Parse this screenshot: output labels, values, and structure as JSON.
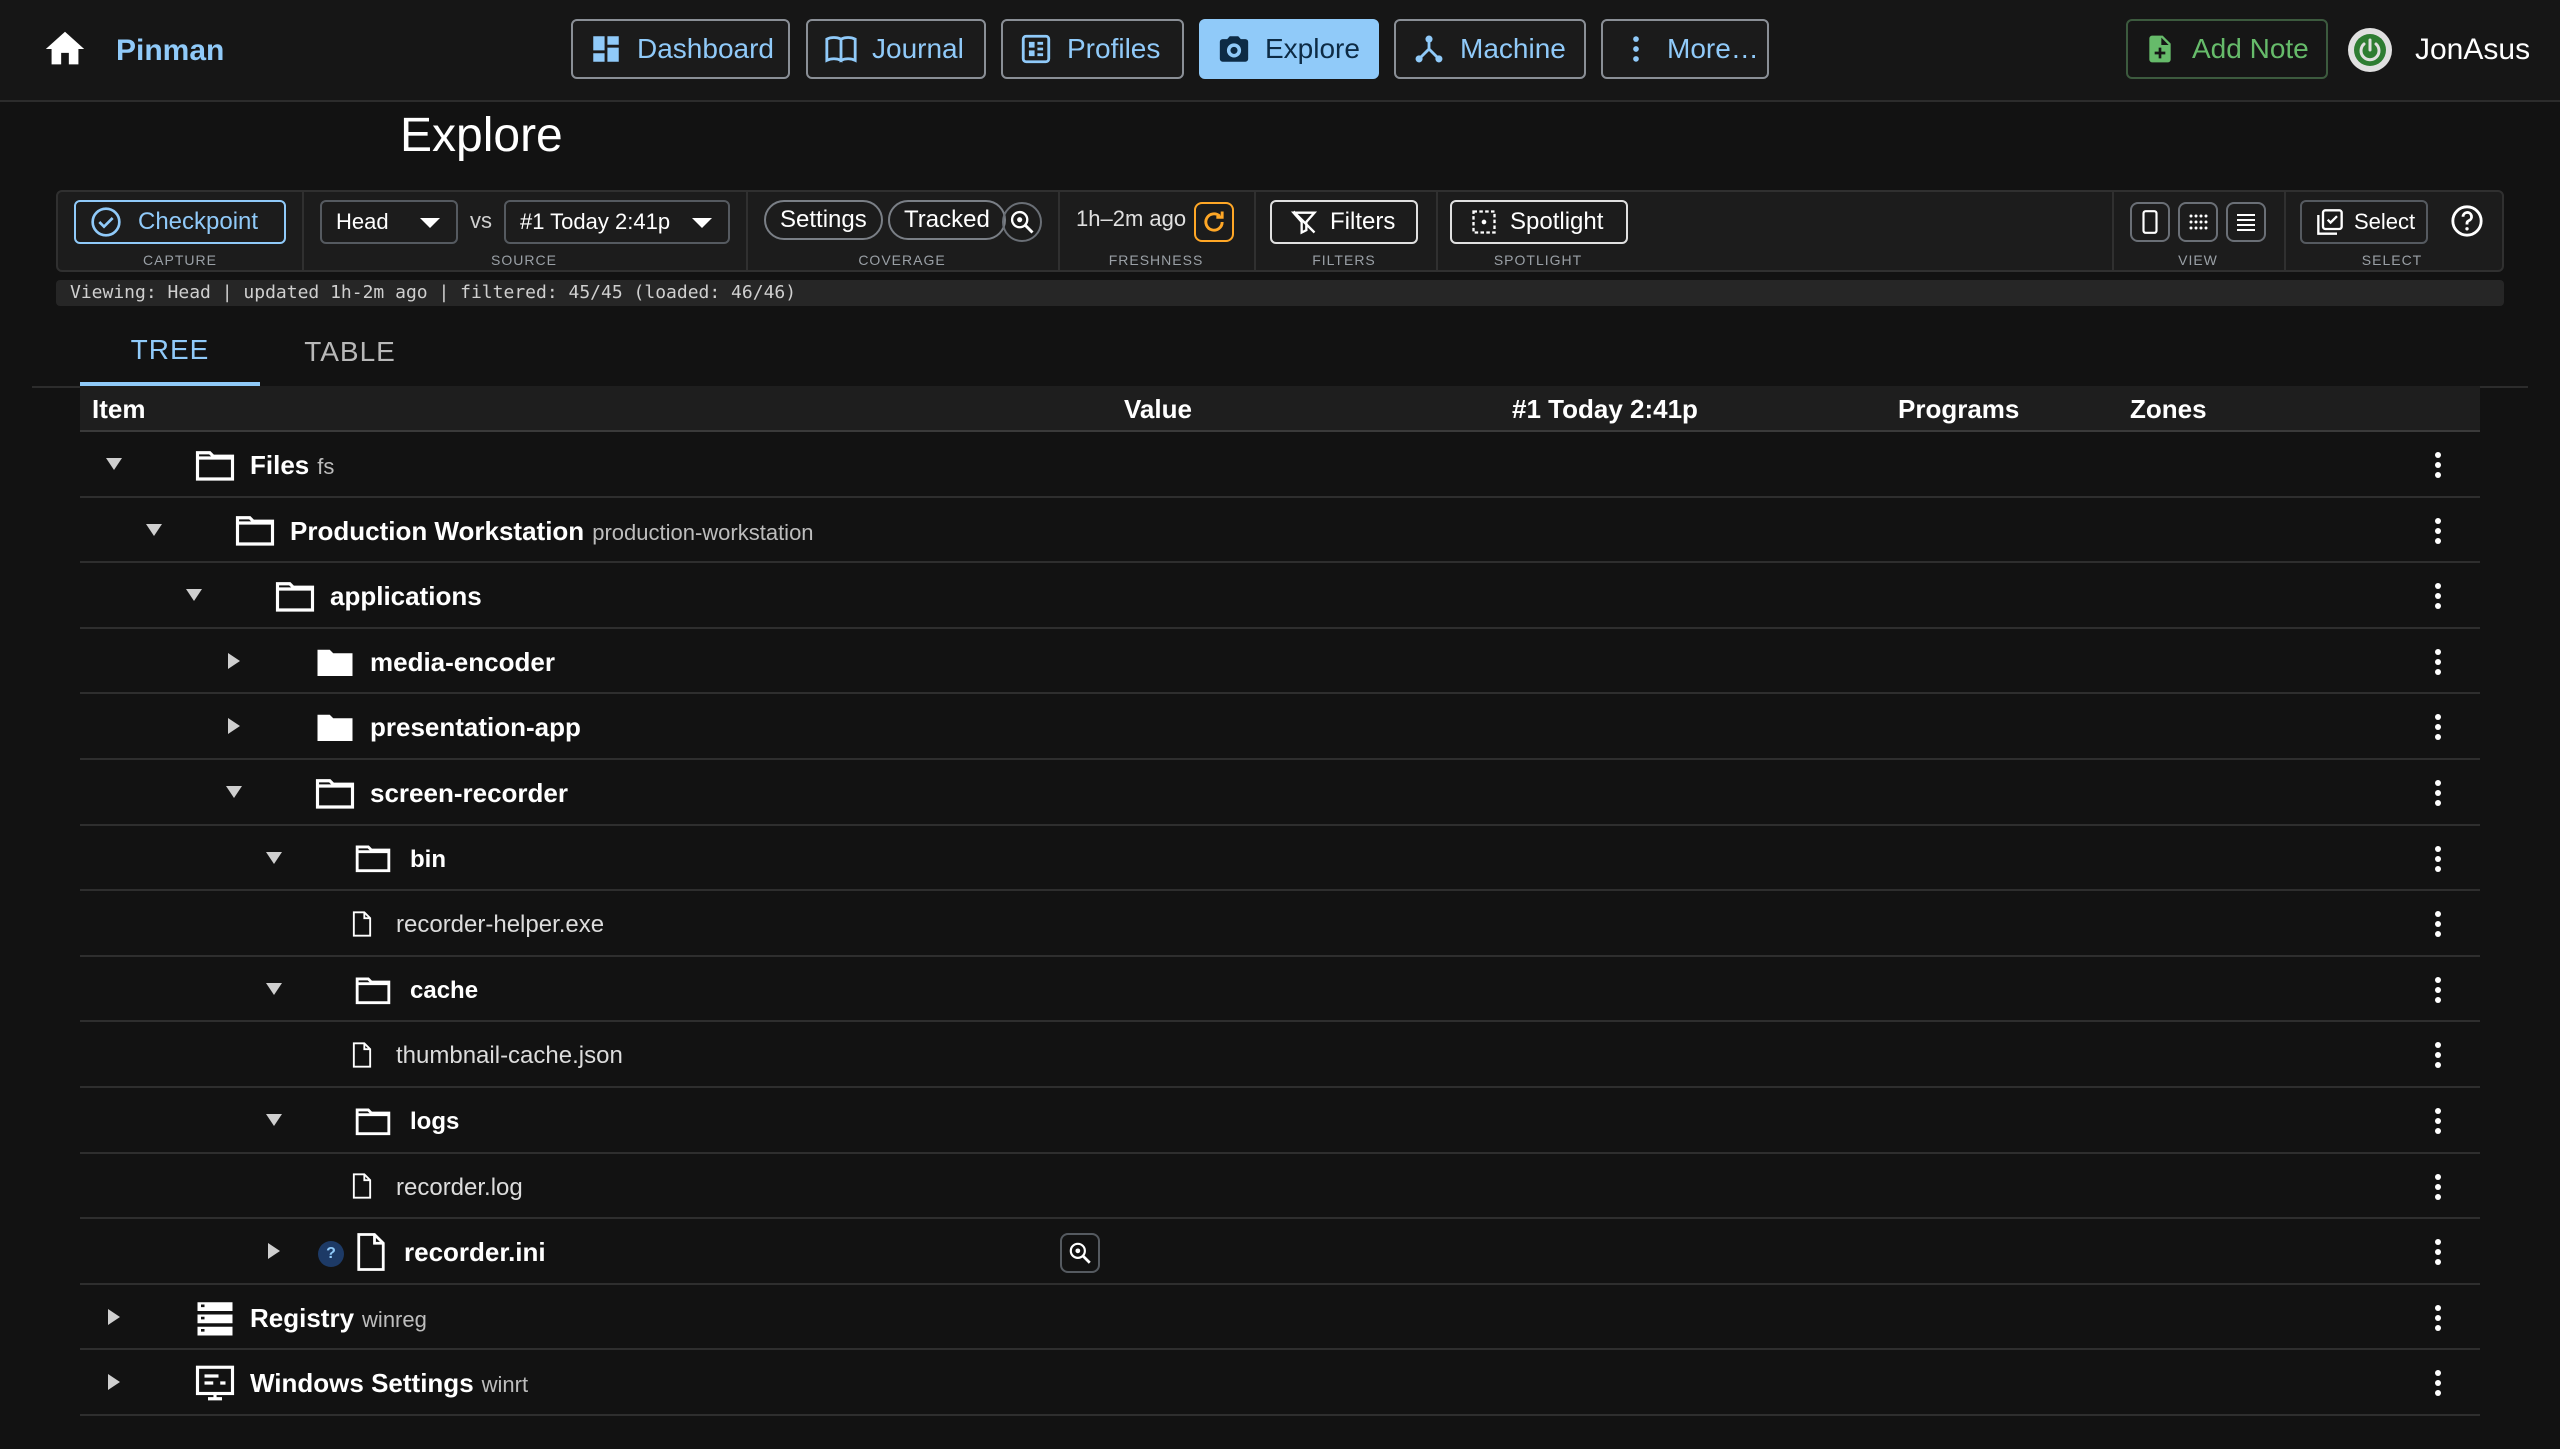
{
  "app": {
    "name": "Pinman",
    "user": "JonAsus"
  },
  "nav": {
    "dashboard": "Dashboard",
    "journal": "Journal",
    "profiles": "Profiles",
    "explore": "Explore",
    "machine": "Machine",
    "more": "More…",
    "active": "Explore",
    "add_note": "Add Note"
  },
  "page": {
    "title": "Explore"
  },
  "toolbar": {
    "checkpoint": "Checkpoint",
    "capture_caption": "CAPTURE",
    "source_left": "Head",
    "vs": "vs",
    "source_right": "#1 Today 2:41p",
    "source_caption": "SOURCE",
    "settings": "Settings",
    "tracked": "Tracked",
    "coverage_caption": "COVERAGE",
    "freshness": "1h–2m ago",
    "freshness_caption": "FRESHNESS",
    "filters": "Filters",
    "filters_caption": "FILTERS",
    "spotlight": "Spotlight",
    "spotlight_caption": "SPOTLIGHT",
    "view_caption": "VIEW",
    "select": "Select",
    "select_caption": "SELECT"
  },
  "status": "Viewing: Head | updated 1h-2m ago | filtered: 45/45 (loaded: 46/46)",
  "tabs": {
    "tree": "TREE",
    "table": "TABLE",
    "active": "TREE"
  },
  "columns": {
    "item": "Item",
    "value": "Value",
    "snapshot": "#1 Today 2:41p",
    "programs": "Programs",
    "zones": "Zones"
  },
  "rows": [
    {
      "label": "Files",
      "sub": "fs",
      "icon": "folder-outline-icon",
      "expanded": true
    },
    {
      "label": "Production Workstation",
      "sub": "production-workstation",
      "icon": "folder-outline-icon",
      "expanded": true
    },
    {
      "label": "applications",
      "sub": "",
      "icon": "folder-outline-icon",
      "expanded": true
    },
    {
      "label": "media-encoder",
      "sub": "",
      "icon": "folder-filled-icon",
      "expanded": false
    },
    {
      "label": "presentation-app",
      "sub": "",
      "icon": "folder-filled-icon",
      "expanded": false
    },
    {
      "label": "screen-recorder",
      "sub": "",
      "icon": "folder-outline-icon",
      "expanded": true
    },
    {
      "label": "bin",
      "sub": "",
      "icon": "folder-outline-icon",
      "expanded": true
    },
    {
      "label": "recorder-helper.exe",
      "sub": "",
      "icon": "file-icon"
    },
    {
      "label": "cache",
      "sub": "",
      "icon": "folder-outline-icon",
      "expanded": true
    },
    {
      "label": "thumbnail-cache.json",
      "sub": "",
      "icon": "file-icon"
    },
    {
      "label": "logs",
      "sub": "",
      "icon": "folder-outline-icon",
      "expanded": true
    },
    {
      "label": "recorder.log",
      "sub": "",
      "icon": "file-icon"
    },
    {
      "label": "recorder.ini",
      "sub": "",
      "icon": "file-icon",
      "expanded": false,
      "badge": "?"
    },
    {
      "label": "Registry",
      "sub": "winreg",
      "icon": "registry-icon",
      "expanded": false
    },
    {
      "label": "Windows Settings",
      "sub": "winrt",
      "icon": "settings-window-icon",
      "expanded": false
    }
  ],
  "colors": {
    "accent": "#90caf9",
    "success": "#66bb6a",
    "warning": "#ffa726",
    "background": "#121212"
  }
}
